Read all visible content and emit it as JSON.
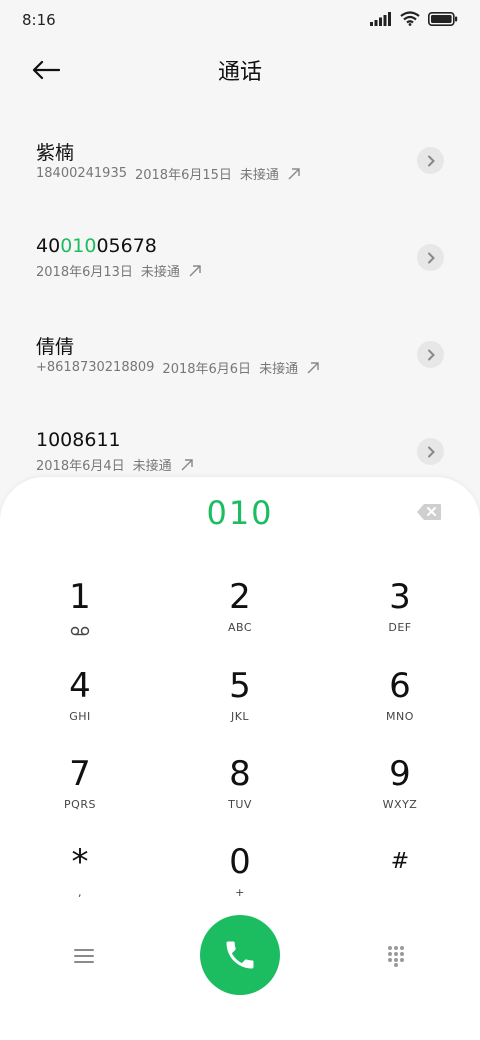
{
  "status_bar": {
    "time": "8:16"
  },
  "header": {
    "title": "通话"
  },
  "call_log": [
    {
      "name_pre": "紫楠",
      "name_hl": "",
      "name_post": "",
      "number": "18400241935",
      "date": "2018年6月15日",
      "status": "未接通"
    },
    {
      "name_pre": "40",
      "name_hl": "010",
      "name_post": "05678",
      "number": "",
      "date": "2018年6月13日",
      "status": "未接通"
    },
    {
      "name_pre": "倩倩",
      "name_hl": "",
      "name_post": "",
      "number": "+8618730218809",
      "date": "2018年6月6日",
      "status": "未接通"
    },
    {
      "name_pre": "1008611",
      "name_hl": "",
      "name_post": "",
      "number": "",
      "date": "2018年6月4日",
      "status": "未接通"
    }
  ],
  "dialer": {
    "input": "010",
    "keys": [
      {
        "digit": "1",
        "letters": ""
      },
      {
        "digit": "2",
        "letters": "ABC"
      },
      {
        "digit": "3",
        "letters": "DEF"
      },
      {
        "digit": "4",
        "letters": "GHI"
      },
      {
        "digit": "5",
        "letters": "JKL"
      },
      {
        "digit": "6",
        "letters": "MNO"
      },
      {
        "digit": "7",
        "letters": "PQRS"
      },
      {
        "digit": "8",
        "letters": "TUV"
      },
      {
        "digit": "9",
        "letters": "WXYZ"
      },
      {
        "digit": "*",
        "letters": ","
      },
      {
        "digit": "0",
        "letters": "+"
      },
      {
        "digit": "#",
        "letters": ""
      }
    ]
  },
  "colors": {
    "accent": "#1bbd60",
    "background": "#f6f6f6",
    "sheet": "#ffffff"
  },
  "icons": {
    "back": "arrow-left-icon",
    "outgoing": "outgoing-arrow-icon",
    "info": "chevron-right-icon",
    "backspace": "backspace-icon",
    "voicemail": "voicemail-icon",
    "menu": "menu-icon",
    "call": "phone-icon",
    "keypad": "keypad-grid-icon"
  }
}
